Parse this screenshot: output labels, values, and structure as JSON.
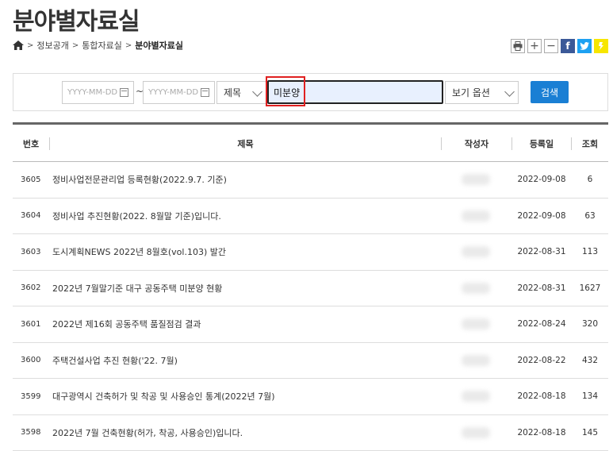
{
  "page": {
    "title": "분야별자료실"
  },
  "breadcrumb": {
    "items": [
      "정보공개",
      "통합자료실",
      "분야별자료실"
    ],
    "separator": ">"
  },
  "toolbar": {
    "plus": "+",
    "minus": "−",
    "facebook": "f"
  },
  "search": {
    "date_start_placeholder": "YYYY-MM-DD",
    "date_end_placeholder": "YYYY-MM-DD",
    "tilde": "~",
    "field_select": "제목",
    "keyword": "미분양",
    "view_option": "보기 옵션",
    "button": "검색"
  },
  "table": {
    "headers": {
      "number": "번호",
      "title": "제목",
      "author": "작성자",
      "date": "등록일",
      "views": "조회"
    },
    "rows": [
      {
        "number": "3605",
        "title": "정비사업전문관리업 등록현황(2022.9.7. 기준)",
        "date": "2022-09-08",
        "views": "6"
      },
      {
        "number": "3604",
        "title": "정비사업 추진현황(2022. 8월말 기준)입니다.",
        "date": "2022-09-08",
        "views": "63"
      },
      {
        "number": "3603",
        "title": "도시계획NEWS 2022년 8월호(vol.103) 발간",
        "date": "2022-08-31",
        "views": "113"
      },
      {
        "number": "3602",
        "title": "2022년 7월말기준 대구 공동주택 미분양 현황",
        "date": "2022-08-31",
        "views": "1627"
      },
      {
        "number": "3601",
        "title": "2022년 제16회 공동주택 품질점검 결과",
        "date": "2022-08-24",
        "views": "320"
      },
      {
        "number": "3600",
        "title": "주택건설사업 추진 현황('22. 7월)",
        "date": "2022-08-22",
        "views": "432"
      },
      {
        "number": "3599",
        "title": "대구광역시 건축허가 및 착공 및 사용승인 통계(2022년 7월)",
        "date": "2022-08-18",
        "views": "134"
      },
      {
        "number": "3598",
        "title": "2022년 7월 건축현황(허가, 착공, 사용승인)입니다.",
        "date": "2022-08-18",
        "views": "145"
      }
    ]
  },
  "colors": {
    "accent": "#1a7fd4",
    "highlight": "#e02020"
  }
}
